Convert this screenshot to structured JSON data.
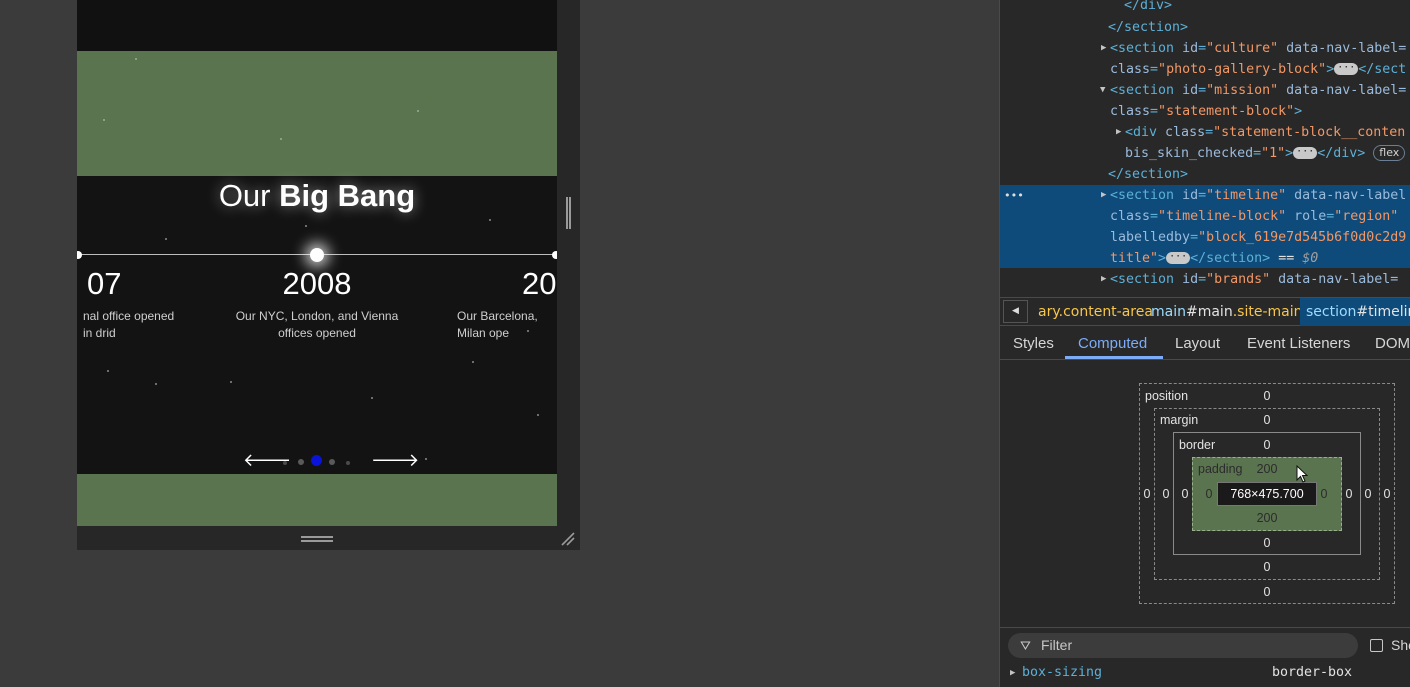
{
  "preview": {
    "title_prefix": "Our ",
    "title_bold": "Big Bang",
    "timeline": [
      {
        "year": "07",
        "desc": "nal office opened in drid"
      },
      {
        "year": "2008",
        "desc": "Our NYC, London, and Vienna offices opened"
      },
      {
        "year": "20",
        "desc": "Our Barcelona, Milan ope"
      }
    ],
    "prev_arrow": "🡐",
    "next_arrow": "🡒",
    "active_pager_color": "#0a14d8",
    "padding_overlay_color": "#5b7450"
  },
  "dom": {
    "lines": [
      {
        "pre": "</div>"
      },
      {
        "pre": "</section>"
      },
      {
        "tag": "<section",
        "id": "culture",
        "rest": " data-nav-label="
      },
      {
        "cls": "photo-gallery-block",
        "after": ">",
        "close": "</sect"
      },
      {
        "tag": "<section",
        "id": "mission",
        "rest": " data-nav-label="
      },
      {
        "cls": "statement-block",
        "after": ">"
      },
      {
        "tag": "<div",
        "cls": "statement-block__conten"
      },
      {
        "attr": "bis_skin_checked",
        "val": "1",
        "after": ">",
        "close": "</div>",
        "badge": "flex"
      },
      {
        "pre": "</section>"
      },
      {
        "tag": "<section",
        "id": "timeline",
        "rest": " data-nav-label"
      },
      {
        "cls": "timeline-block",
        "role": "region"
      },
      {
        "labelledby": "block_619e7d545b6f0d0c2d9"
      },
      {
        "title": "title",
        "close": "</section>",
        "eq": " == ",
        "dollar": "$0"
      },
      {
        "tag": "<section",
        "id": "brands",
        "rest": " data-nav-label="
      }
    ],
    "selected_dots": "•••"
  },
  "breadcrumbs": [
    {
      "el": "",
      "cls": "ary.content-area"
    },
    {
      "el": "main",
      "id": "#main",
      "cls": ".site-main"
    },
    {
      "el": "section",
      "id": "#timeline"
    }
  ],
  "tabs": [
    "Styles",
    "Computed",
    "Layout",
    "Event Listeners",
    "DOM"
  ],
  "active_tab": "Computed",
  "box_model": {
    "position_label": "position",
    "position_top": "0",
    "position_bottom": "0",
    "position_left": "0",
    "position_right": "0",
    "margin_label": "margin",
    "margin_top": "0",
    "margin_bottom": "0",
    "margin_left": "0",
    "margin_right": "0",
    "border_label": "border",
    "border_top": "0",
    "border_bottom": "0",
    "border_left": "0",
    "border_right": "0",
    "padding_label": "padding",
    "padding_top": "200",
    "padding_bottom": "200",
    "padding_left": "0",
    "padding_right": "0",
    "content": "768×475.700"
  },
  "filter": {
    "placeholder": "Filter",
    "show_all": "Sho"
  },
  "computed": [
    {
      "name": "box-sizing",
      "value": "border-box"
    }
  ]
}
